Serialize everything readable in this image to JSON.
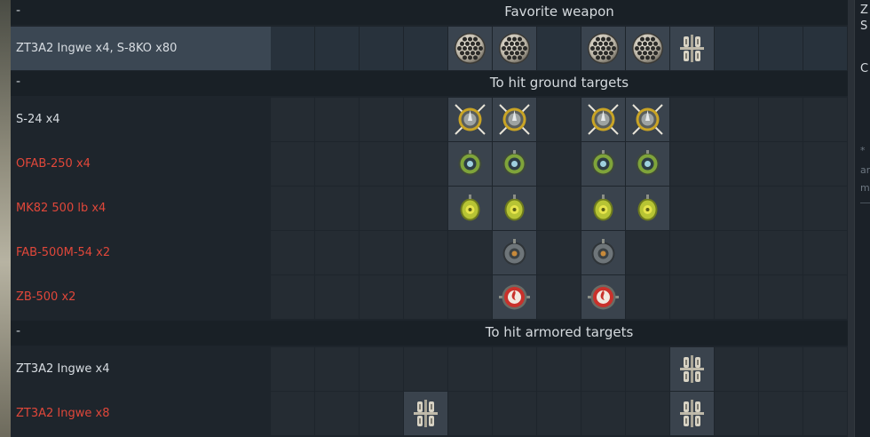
{
  "sections": [
    {
      "title": "Favorite weapon",
      "dash": "-",
      "rows": [
        {
          "label": "ZT3A2 Ingwe x4,  S-8KO x80",
          "color": "white",
          "favorite": true,
          "slots": [
            {
              "col": 4,
              "icon": "rocket-pod-icon"
            },
            {
              "col": 5,
              "icon": "rocket-pod-icon"
            },
            {
              "col": 7,
              "icon": "rocket-pod-icon"
            },
            {
              "col": 8,
              "icon": "rocket-pod-icon"
            },
            {
              "col": 9,
              "icon": "atgm-launcher-icon"
            }
          ]
        }
      ]
    },
    {
      "title": "To hit ground targets",
      "dash": "-",
      "rows": [
        {
          "label": "S-24 x4",
          "color": "white",
          "slots": [
            {
              "col": 4,
              "icon": "large-rocket-icon"
            },
            {
              "col": 5,
              "icon": "large-rocket-icon"
            },
            {
              "col": 7,
              "icon": "large-rocket-icon"
            },
            {
              "col": 8,
              "icon": "large-rocket-icon"
            }
          ]
        },
        {
          "label": "OFAB-250 x4",
          "color": "red",
          "slots": [
            {
              "col": 4,
              "icon": "green-bomb-icon"
            },
            {
              "col": 5,
              "icon": "green-bomb-icon"
            },
            {
              "col": 7,
              "icon": "green-bomb-icon"
            },
            {
              "col": 8,
              "icon": "green-bomb-icon"
            }
          ]
        },
        {
          "label": "MK82 500 lb x4",
          "color": "red",
          "slots": [
            {
              "col": 4,
              "icon": "yellow-bomb-icon"
            },
            {
              "col": 5,
              "icon": "yellow-bomb-icon"
            },
            {
              "col": 7,
              "icon": "yellow-bomb-icon"
            },
            {
              "col": 8,
              "icon": "yellow-bomb-icon"
            }
          ]
        },
        {
          "label": "FAB-500M-54 x2",
          "color": "red",
          "slots": [
            {
              "col": 5,
              "icon": "grey-bomb-icon"
            },
            {
              "col": 7,
              "icon": "grey-bomb-icon"
            }
          ]
        },
        {
          "label": "ZB-500 x2",
          "color": "red",
          "slots": [
            {
              "col": 5,
              "icon": "incendiary-bomb-icon"
            },
            {
              "col": 7,
              "icon": "incendiary-bomb-icon"
            }
          ]
        }
      ]
    },
    {
      "title": "To hit armored targets",
      "dash": "-",
      "rows": [
        {
          "label": "ZT3A2 Ingwe x4",
          "color": "white",
          "slots": [
            {
              "col": 9,
              "icon": "atgm-launcher-icon"
            }
          ]
        },
        {
          "label": "ZT3A2 Ingwe x8",
          "color": "red",
          "slots": [
            {
              "col": 3,
              "icon": "atgm-launcher-icon"
            },
            {
              "col": 9,
              "icon": "atgm-launcher-icon"
            }
          ]
        }
      ]
    }
  ],
  "side_panel": {
    "line1": "Z",
    "line2": "S",
    "line3": "C",
    "line4": "*",
    "line5": "ar",
    "line6": "m"
  }
}
